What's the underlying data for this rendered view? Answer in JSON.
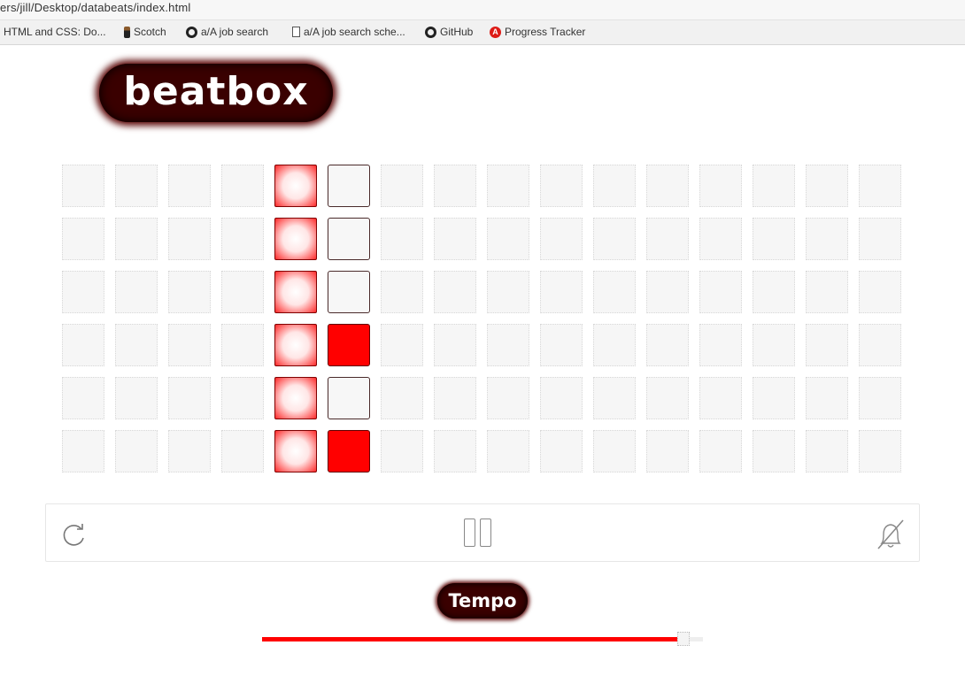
{
  "browser": {
    "url": "ers/jill/Desktop/databeats/index.html",
    "bookmarks": [
      {
        "label": "HTML and CSS: Do...",
        "icon": "none"
      },
      {
        "label": "Scotch",
        "icon": "scotch-icon"
      },
      {
        "label": "a/A job search",
        "icon": "github-icon"
      },
      {
        "label": "a/A job search sche...",
        "icon": "document-icon"
      },
      {
        "label": "GitHub",
        "icon": "github-icon"
      },
      {
        "label": "Progress Tracker",
        "icon": "progress-tracker-icon"
      }
    ]
  },
  "app": {
    "logo_text": "beatbox",
    "tempo_label": "Tempo",
    "tempo_value_percent": 97
  },
  "sequencer": {
    "rows": 6,
    "columns": 16,
    "playing_column": 5,
    "current_column": 6,
    "current_column_on_rows": [
      4,
      6
    ]
  },
  "colors": {
    "accent": "#ff0000",
    "logo_bg": "#3a0000",
    "pad_bg": "#f6f6f6"
  },
  "controls": {
    "reset_icon": "refresh-icon",
    "pause_icon": "pause-icon",
    "mute_icon": "bell-slash-icon"
  }
}
